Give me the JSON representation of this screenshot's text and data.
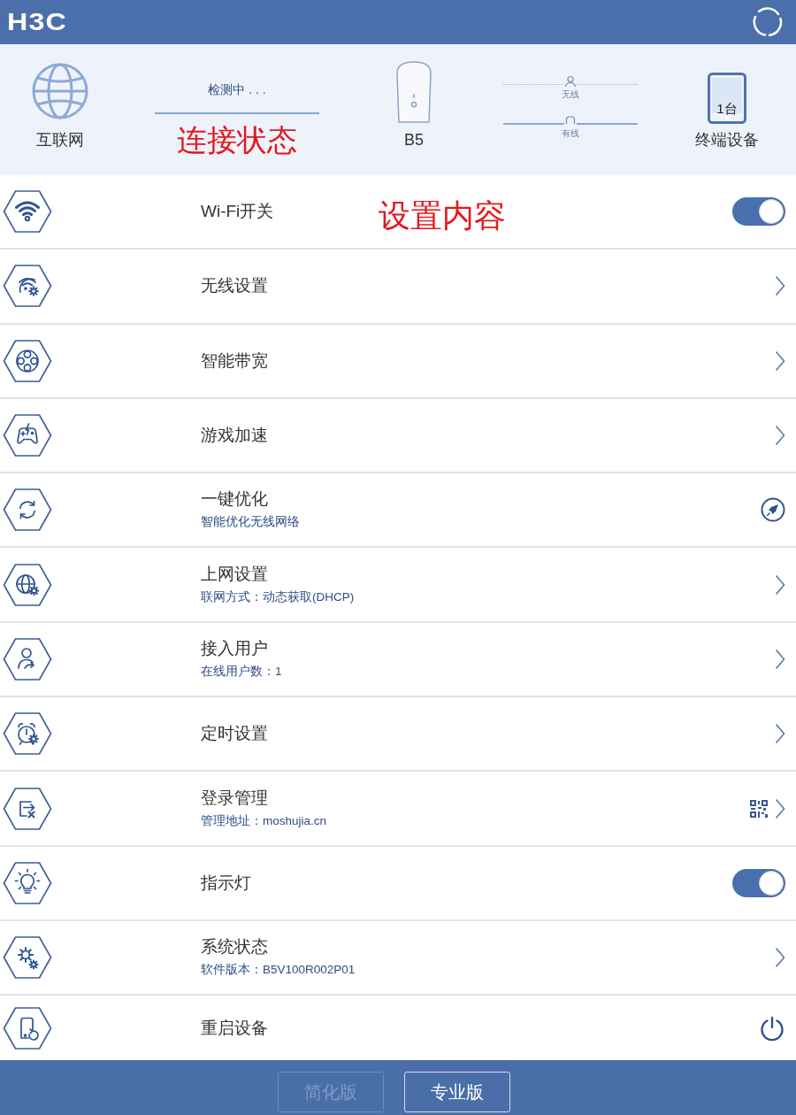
{
  "header": {
    "logo": "H3C"
  },
  "status": {
    "internet_label": "互联网",
    "connection_status": "检测中 . . .",
    "annotation": "连接状态",
    "router_label": "B5",
    "wireless_label": "无线",
    "wired_label": "有线",
    "device_count": "1台",
    "devices_label": "终端设备"
  },
  "settings": {
    "annotation": "设置内容",
    "rows": [
      {
        "title": "Wi-Fi开关",
        "kind": "toggle",
        "on": true
      },
      {
        "title": "无线设置",
        "kind": "link"
      },
      {
        "title": "智能带宽",
        "kind": "link"
      },
      {
        "title": "游戏加速",
        "kind": "link"
      },
      {
        "title": "一键优化",
        "subtitle": "智能优化无线网络",
        "kind": "optimize"
      },
      {
        "title": "上网设置",
        "subtitle": "联网方式：动态获取(DHCP)",
        "kind": "link"
      },
      {
        "title": "接入用户",
        "subtitle": "在线用户数：1",
        "kind": "link"
      },
      {
        "title": "定时设置",
        "kind": "link"
      },
      {
        "title": "登录管理",
        "subtitle": "管理地址：moshujia.cn",
        "kind": "qr_link"
      },
      {
        "title": "指示灯",
        "kind": "toggle",
        "on": true
      },
      {
        "title": "系统状态",
        "subtitle": "软件版本：B5V100R002P01",
        "kind": "link"
      },
      {
        "title": "重启设备",
        "kind": "power"
      }
    ]
  },
  "footer": {
    "buttons": [
      {
        "label": "简化版",
        "disabled": true
      },
      {
        "label": "专业版",
        "disabled": false
      }
    ]
  }
}
